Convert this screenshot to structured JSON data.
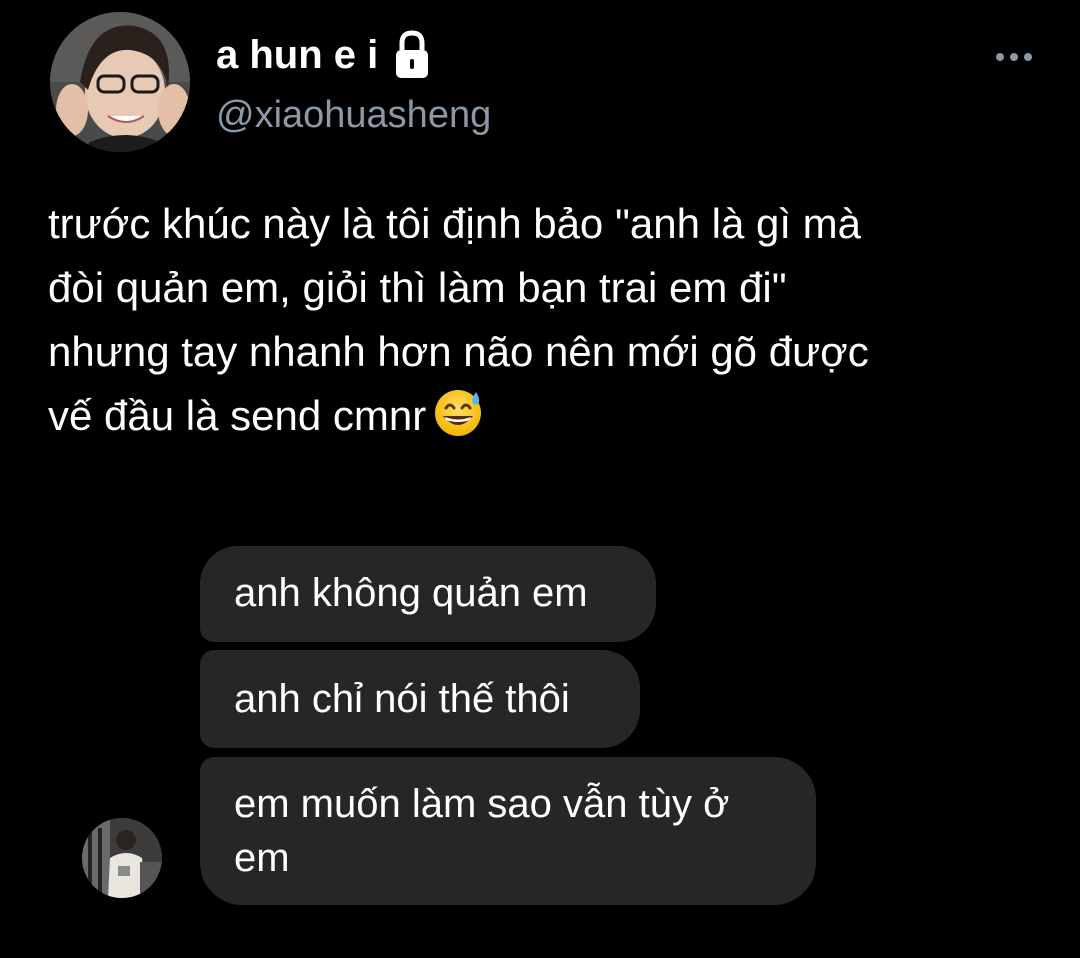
{
  "tweet": {
    "author": {
      "display_name": "a hun e i",
      "handle": "@xiaohuasheng",
      "avatar_icon": "profile-photo",
      "protected_icon": "lock-icon"
    },
    "menu_icon": "more-icon",
    "text_lines": [
      "trước khúc này là tôi định bảo \"anh là gì mà",
      "đòi quản em, giỏi thì làm bạn trai em đi\"",
      "nhưng tay nhanh hơn não nên mới gõ được",
      "vế đầu là send cmnr"
    ],
    "emoji": "grinning-face-with-sweat-icon"
  },
  "chat": {
    "messages": [
      {
        "text": "anh không quản em"
      },
      {
        "text": "anh chỉ nói thế thôi"
      },
      {
        "text": "em muốn làm sao vẫn tùy ở em"
      }
    ],
    "sender_avatar_icon": "chat-avatar-photo"
  },
  "colors": {
    "background": "#000000",
    "text": "#ffffff",
    "secondary_text": "#8b98a5",
    "bubble": "#262626"
  }
}
